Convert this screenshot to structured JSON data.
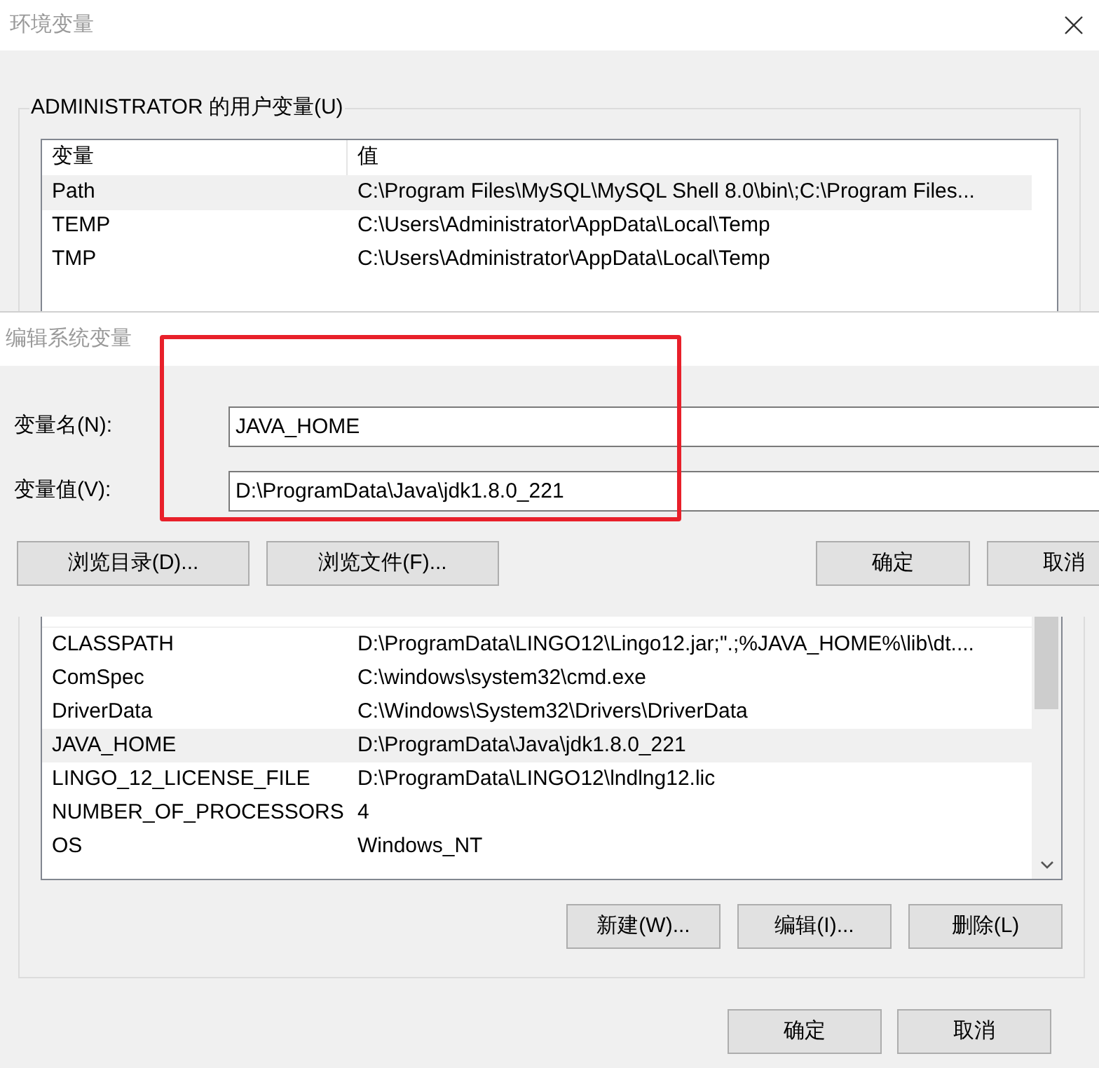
{
  "window": {
    "title": "环境变量"
  },
  "user_variables": {
    "label": "ADMINISTRATOR 的用户变量(U)",
    "columns": [
      "变量",
      "值"
    ],
    "rows": [
      {
        "name": "Path",
        "value": "C:\\Program Files\\MySQL\\MySQL Shell 8.0\\bin\\;C:\\Program Files...",
        "selected": true
      },
      {
        "name": "TEMP",
        "value": "C:\\Users\\Administrator\\AppData\\Local\\Temp",
        "selected": false
      },
      {
        "name": "TMP",
        "value": "C:\\Users\\Administrator\\AppData\\Local\\Temp",
        "selected": false
      }
    ]
  },
  "system_variables": {
    "rows": [
      {
        "name": "CLASSPATH",
        "value": "D:\\ProgramData\\LINGO12\\Lingo12.jar;\".;%JAVA_HOME%\\lib\\dt....",
        "selected": false
      },
      {
        "name": "ComSpec",
        "value": "C:\\windows\\system32\\cmd.exe",
        "selected": false
      },
      {
        "name": "DriverData",
        "value": "C:\\Windows\\System32\\Drivers\\DriverData",
        "selected": false
      },
      {
        "name": "JAVA_HOME",
        "value": "D:\\ProgramData\\Java\\jdk1.8.0_221",
        "selected": true
      },
      {
        "name": "LINGO_12_LICENSE_FILE",
        "value": "D:\\ProgramData\\LINGO12\\lndlng12.lic",
        "selected": false
      },
      {
        "name": "NUMBER_OF_PROCESSORS",
        "value": "4",
        "selected": false
      },
      {
        "name": "OS",
        "value": "Windows_NT",
        "selected": false
      }
    ],
    "buttons": [
      "新建(W)...",
      "编辑(I)...",
      "删除(L)"
    ]
  },
  "buttons": [
    "确定",
    "取消"
  ],
  "edit_dialog": {
    "title": "编辑系统变量",
    "fields": [
      {
        "label": "变量名(N):",
        "value": "JAVA_HOME"
      },
      {
        "label": "变量值(V):",
        "value": "D:\\ProgramData\\Java\\jdk1.8.0_221"
      }
    ],
    "browse_buttons": [
      "浏览目录(D)...",
      "浏览文件(F)..."
    ],
    "buttons": [
      "确定",
      "取消"
    ]
  }
}
